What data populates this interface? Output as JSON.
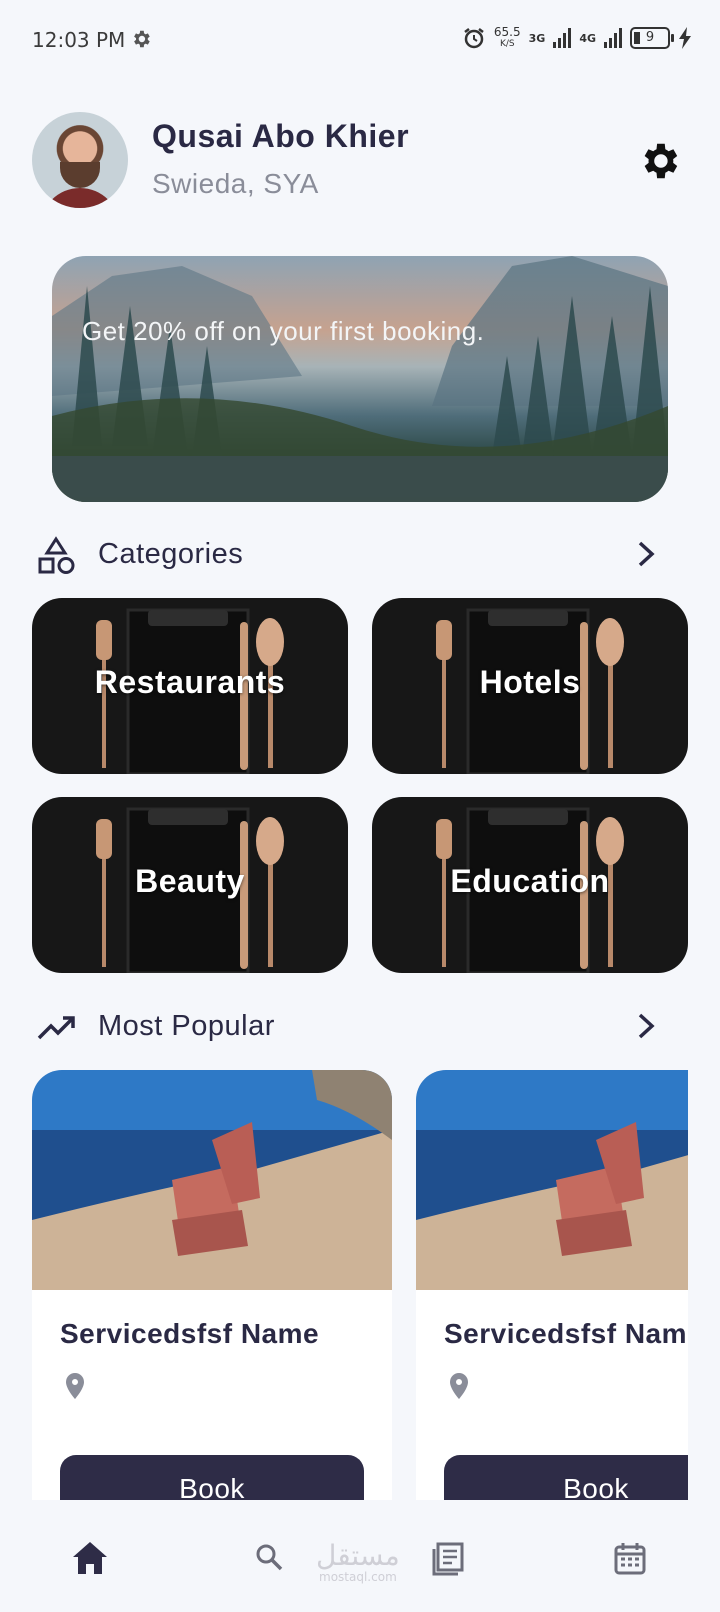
{
  "status_bar": {
    "time": "12:03 PM",
    "speed": "65.5",
    "speed_unit": "K/S",
    "network_1": "3G",
    "network_2": "4G",
    "battery": "9",
    "icons": [
      "settings-icon",
      "alarm-icon",
      "signal-icon",
      "battery-icon",
      "charging-icon"
    ]
  },
  "profile": {
    "name": "Qusai Abo Khier",
    "location": "Swieda, SYA"
  },
  "banner": {
    "text": "Get 20% off on your first booking."
  },
  "categories": {
    "title": "Categories",
    "items": [
      {
        "label": "Restaurants"
      },
      {
        "label": "Hotels"
      },
      {
        "label": "Beauty"
      },
      {
        "label": "Education"
      }
    ]
  },
  "popular": {
    "title": "Most Popular",
    "items": [
      {
        "name": "Servicedsfsf Name",
        "button": "Book"
      },
      {
        "name": "Servicedsfsf Name",
        "button": "Book"
      }
    ]
  },
  "nav": {
    "items": [
      "home-icon",
      "search-icon",
      "news-icon",
      "calendar-icon"
    ],
    "watermark_ar": "مستقل",
    "watermark_lat": "mostaql.com"
  },
  "colors": {
    "primary": "#2e2c47",
    "background": "#f5f7fb",
    "muted": "#8a8d99"
  }
}
